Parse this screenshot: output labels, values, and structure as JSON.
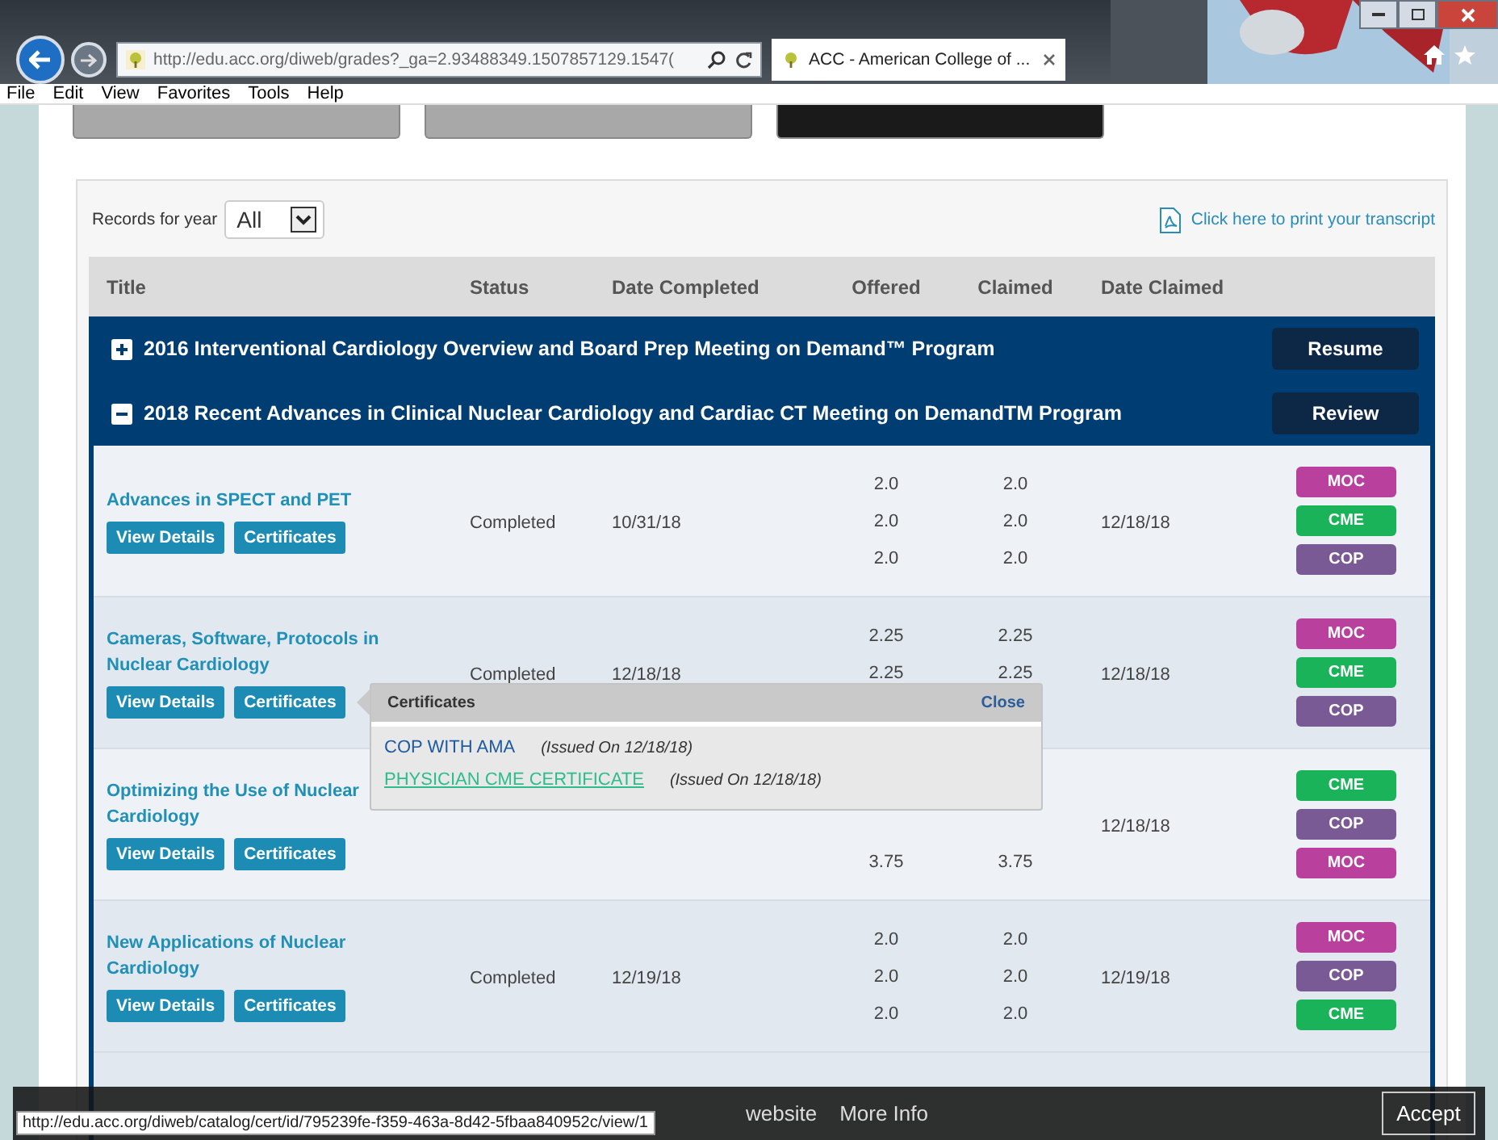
{
  "browser": {
    "address": "http://edu.acc.org/diweb/grades?_ga=2.93488349.1507857129.1547(",
    "tab_title": "ACC - American College of ...",
    "menu": [
      "File",
      "Edit",
      "View",
      "Favorites",
      "Tools",
      "Help"
    ]
  },
  "filter": {
    "label": "Records for year",
    "value": "All"
  },
  "print_link": "Click here to print your transcript",
  "columns": [
    "Title",
    "Status",
    "Date Completed",
    "Offered",
    "Claimed",
    "Date Claimed"
  ],
  "programs": [
    {
      "title": "2016 Interventional Cardiology Overview and Board Prep Meeting on Demand™ Program",
      "expanded": false,
      "action": "Resume"
    },
    {
      "title": "2018 Recent Advances in Clinical Nuclear Cardiology and Cardiac CT Meeting on DemandTM Program",
      "expanded": true,
      "action": "Review"
    }
  ],
  "rows": [
    {
      "title": "Advances in SPECT and PET",
      "status": "Completed",
      "date_completed": "10/31/18",
      "offered": [
        "2.0",
        "2.0",
        "2.0"
      ],
      "claimed": [
        "2.0",
        "2.0",
        "2.0"
      ],
      "date_claimed": "12/18/18",
      "buttons": [
        "View Details",
        "Certificates"
      ],
      "badges": [
        {
          "label": "MOC",
          "color": "#b9409c"
        },
        {
          "label": "CME",
          "color": "#1bb35a"
        },
        {
          "label": "COP",
          "color": "#7a5a95"
        }
      ]
    },
    {
      "title": "Cameras, Software, Protocols in Nuclear Cardiology",
      "status": "Completed",
      "date_completed": "12/18/18",
      "offered": [
        "2.25",
        "2.25"
      ],
      "claimed": [
        "2.25",
        "2.25"
      ],
      "date_claimed": "12/18/18",
      "buttons": [
        "View Details",
        "Certificates"
      ],
      "badges": [
        {
          "label": "MOC",
          "color": "#b9409c"
        },
        {
          "label": "CME",
          "color": "#1bb35a"
        },
        {
          "label": "COP",
          "color": "#7a5a95"
        }
      ]
    },
    {
      "title": "Optimizing the Use of Nuclear Cardiology",
      "offered": [
        "3.75"
      ],
      "claimed": [
        "3.75"
      ],
      "date_claimed": "12/18/18",
      "buttons": [
        "View Details",
        "Certificates"
      ],
      "badges": [
        {
          "label": "CME",
          "color": "#1bb35a"
        },
        {
          "label": "COP",
          "color": "#7a5a95"
        },
        {
          "label": "MOC",
          "color": "#b9409c"
        }
      ]
    },
    {
      "title": "New Applications of Nuclear Cardiology",
      "status": "Completed",
      "date_completed": "12/19/18",
      "offered": [
        "2.0",
        "2.0",
        "2.0"
      ],
      "claimed": [
        "2.0",
        "2.0",
        "2.0"
      ],
      "date_claimed": "12/19/18",
      "buttons": [
        "View Details",
        "Certificates"
      ],
      "badges": [
        {
          "label": "MOC",
          "color": "#b9409c"
        },
        {
          "label": "COP",
          "color": "#7a5a95"
        },
        {
          "label": "CME",
          "color": "#1bb35a"
        }
      ]
    }
  ],
  "popover": {
    "title": "Certificates",
    "close": "Close",
    "items": [
      {
        "name": "COP WITH AMA",
        "issued": "(Issued On 12/18/18)",
        "highlighted": false
      },
      {
        "name": "PHYSICIAN CME CERTIFICATE",
        "issued": "(Issued On 12/18/18)",
        "highlighted": true
      }
    ]
  },
  "cookie_bar": {
    "texts": [
      "website",
      "More Info"
    ],
    "button": "Accept"
  },
  "status_url": "http://edu.acc.org/diweb/catalog/cert/id/795239fe-f359-463a-8d42-5fbaa840952c/view/1"
}
